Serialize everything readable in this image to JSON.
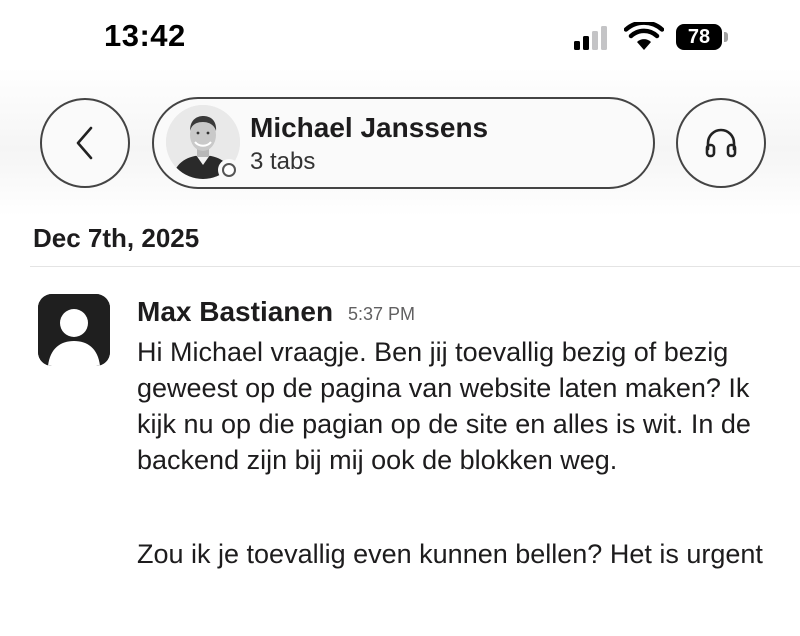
{
  "status_bar": {
    "time": "13:42",
    "battery": "78",
    "signal_icon": "cellular-signal-icon",
    "wifi_icon": "wifi-icon"
  },
  "header": {
    "back_icon": "chevron-left-icon",
    "contact_name": "Michael Janssens",
    "contact_subtitle": "3 tabs",
    "presence": "away",
    "huddle_icon": "headphones-icon"
  },
  "conversation": {
    "date": "Dec 7th, 2025",
    "messages": [
      {
        "sender": "Max Bastianen",
        "time": "5:37 PM",
        "paragraphs": [
          "Hi Michael vraagje. Ben jij toevallig bezig of bezig geweest op de pagina van website laten maken? Ik kijk nu op die pagian op de site en alles is wit. In de backend zijn bij mij ook de blokken weg.",
          "Zou ik je toevallig even kunnen bellen? Het is urgent"
        ]
      }
    ]
  },
  "colors": {
    "text": "#1d1c1d",
    "muted": "#616061",
    "border": "#444444",
    "default_avatar": "#1f1f1f"
  }
}
